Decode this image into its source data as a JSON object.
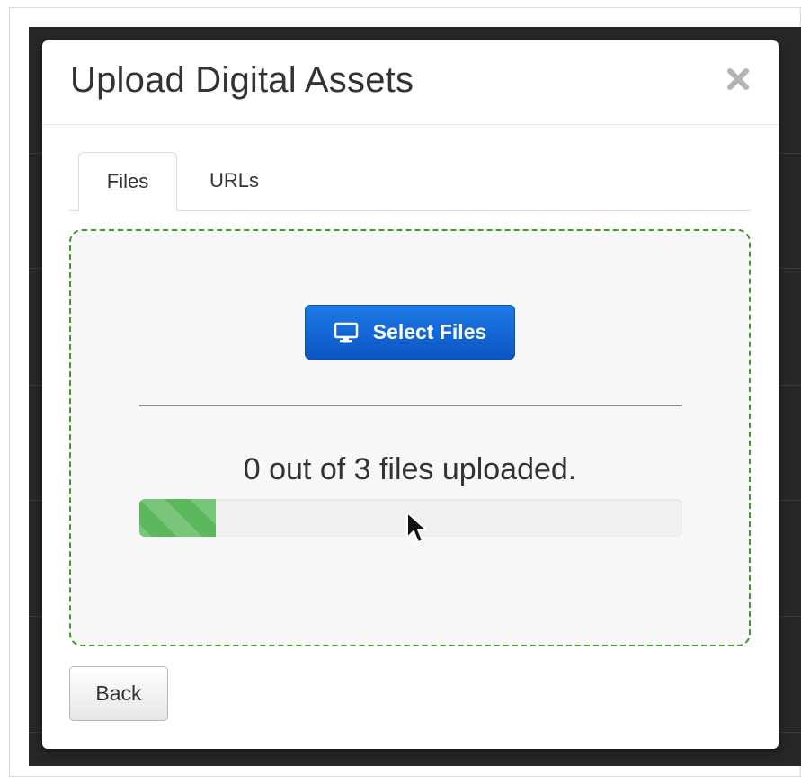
{
  "modal": {
    "title": "Upload Digital Assets",
    "close_icon": "close-icon"
  },
  "tabs": [
    {
      "label": "Files",
      "active": true
    },
    {
      "label": "URLs",
      "active": false
    }
  ],
  "dropzone": {
    "select_files_label": "Select Files",
    "select_files_icon": "monitor-icon",
    "status_text": "0 out of 3 files uploaded.",
    "progress_fraction": 0.14
  },
  "footer": {
    "back_label": "Back"
  },
  "colors": {
    "primary_button": "#0a62d0",
    "progress_fill": "#5cb85c",
    "dropzone_border": "#3f9a2b"
  }
}
